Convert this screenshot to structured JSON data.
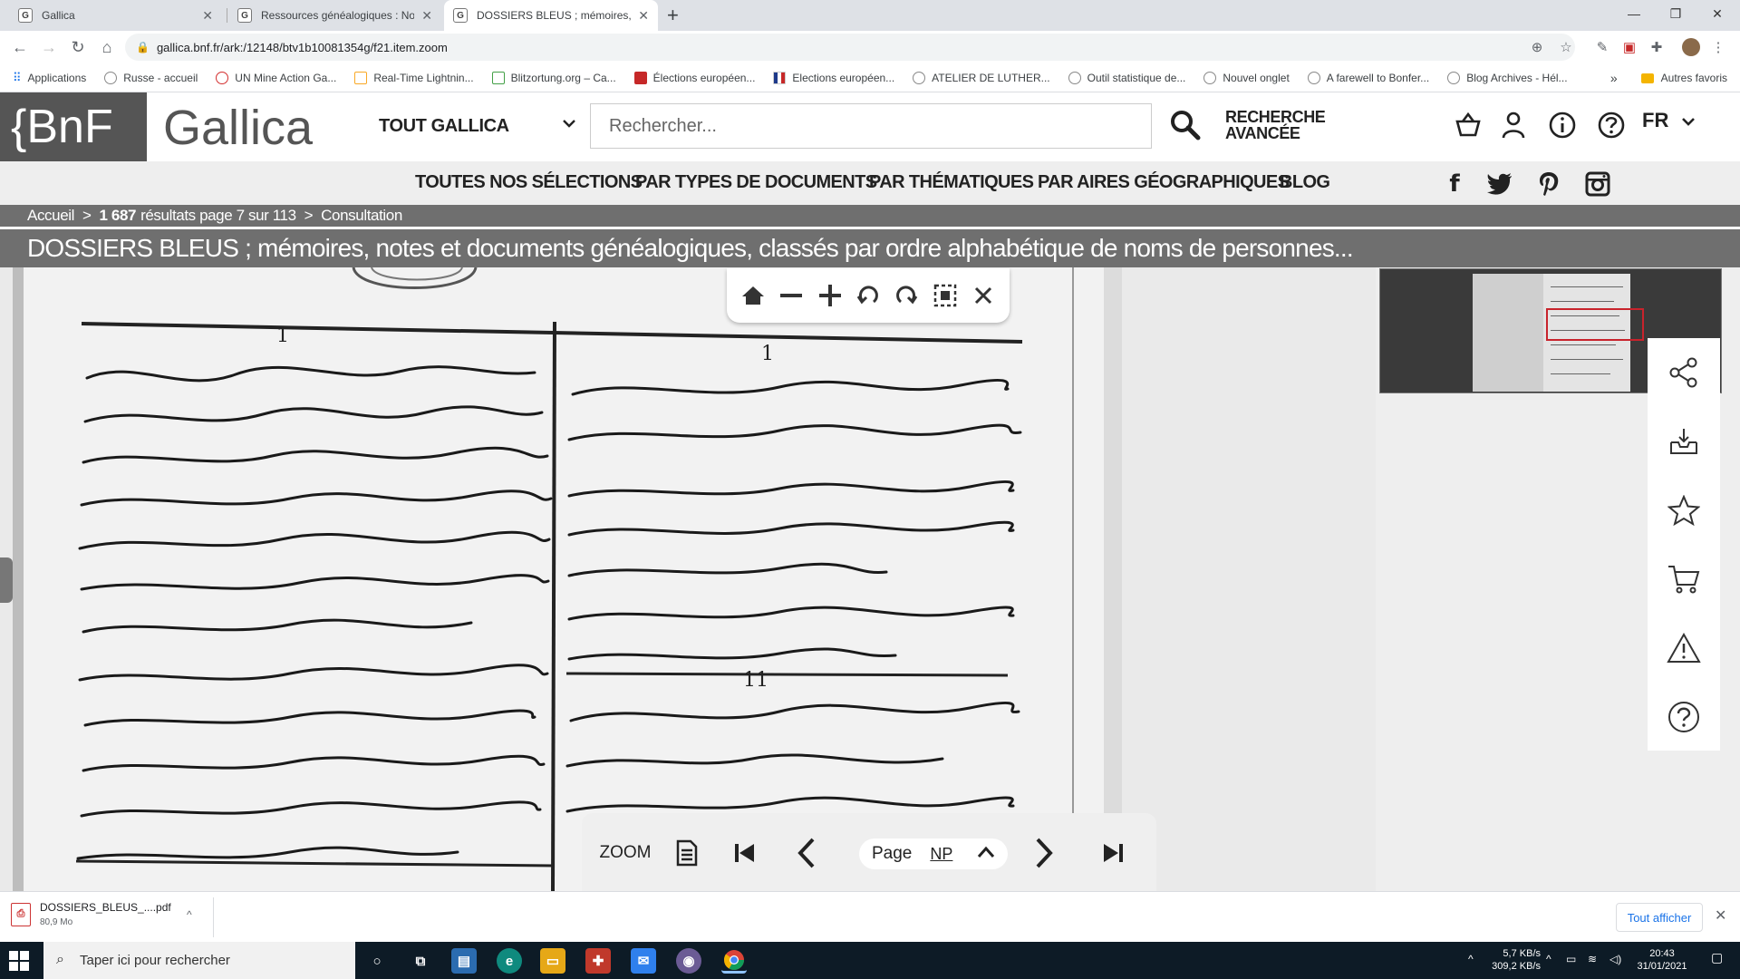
{
  "browser": {
    "tabs": [
      {
        "favicon": "G",
        "title": "Gallica",
        "active": false
      },
      {
        "favicon": "G",
        "title": "Ressources généalogiques : Nobl",
        "active": false
      },
      {
        "favicon": "G",
        "title": "DOSSIERS BLEUS ; mémoires, not",
        "active": true
      }
    ],
    "url": "gallica.bnf.fr/ark:/12148/btv1b10081354g/f21.item.zoom",
    "bookmarks": [
      "Applications",
      "Russe - accueil",
      "UN Mine Action Ga...",
      "Real-Time Lightnin...",
      "Blitzortung.org – Ca...",
      "Élections européen...",
      "Elections européen...",
      "ATELIER DE LUTHER...",
      "Outil statistique de...",
      "Nouvel onglet",
      "A farewell to Bonfer...",
      "Blog Archives - Hél..."
    ],
    "bookmarks_more": "»",
    "other_favorites": "Autres favoris"
  },
  "header": {
    "bnf_logo": "{BnF",
    "gallica_logo": "Gallica",
    "scope": "TOUT GALLICA",
    "search_placeholder": "Rechercher...",
    "advanced_search_line1": "RECHERCHE",
    "advanced_search_line2": "AVANCÉE",
    "lang": "FR"
  },
  "nav": {
    "items": [
      "TOUTES NOS SÉLECTIONS",
      "PAR TYPES DE DOCUMENTS",
      "PAR THÉMATIQUES",
      "PAR AIRES GÉOGRAPHIQUES",
      "BLOG"
    ]
  },
  "breadcrumb": {
    "home": "Accueil",
    "results_count": "1 687",
    "results_text": "résultats page 7 sur 113",
    "current": "Consultation",
    "separator": ">"
  },
  "document": {
    "title": "DOSSIERS BLEUS ; mémoires, notes et documents généalogiques, classés par ordre alphabétique de noms de personnes..."
  },
  "viewer": {
    "zoom_label": "ZOOM",
    "page_label": "Page",
    "page_value": "NP"
  },
  "downloads": {
    "file_name": "DOSSIERS_BLEUS_....pdf",
    "file_size": "80,9 Mo",
    "show_all": "Tout afficher"
  },
  "taskbar": {
    "search_placeholder": "Taper ici pour rechercher",
    "net_up": "5,7 KB/s",
    "net_down": "309,2 KB/s",
    "time": "20:43",
    "date": "31/01/2021"
  }
}
